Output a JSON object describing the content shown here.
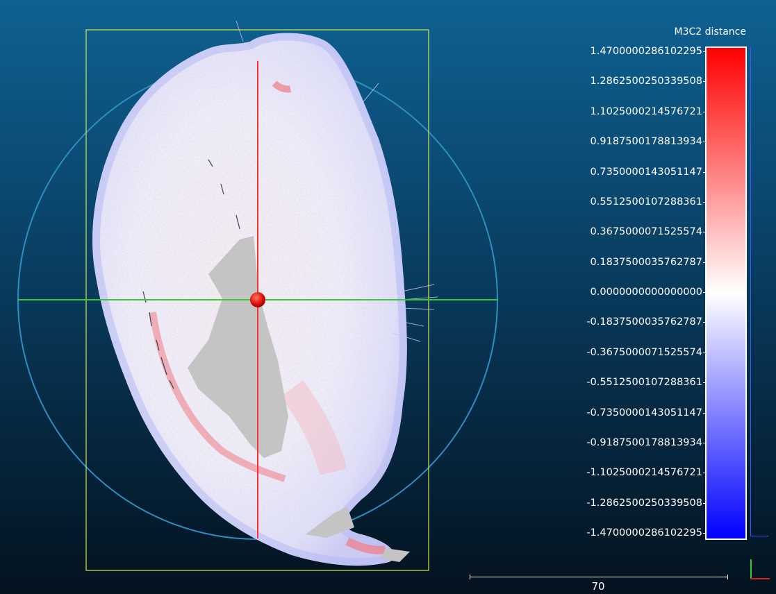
{
  "scalar_field": {
    "title": "M3C2 distance",
    "labels": [
      "1.4700000286102295",
      "1.2862500250339508",
      "1.1025000214576721",
      "0.9187500178813934",
      "0.7350000143051147",
      "0.5512500107288361",
      "0.3675000071525574",
      "0.1837500035762787",
      "0.0000000000000000",
      "-0.1837500035762787",
      "-0.3675000071525574",
      "-0.5512500107288361",
      "-0.7350000143051147",
      "-0.9187500178813934",
      "-1.1025000214576721",
      "-1.2862500250339508",
      "-1.4700000286102295"
    ],
    "colors": {
      "max": "#ff0000",
      "zero": "#ffffff",
      "min": "#0000ff"
    }
  },
  "scale": {
    "label": "70"
  },
  "colors": {
    "background_top": "#0e6192",
    "background_bottom": "#03121f",
    "bbox": "#d4e84a",
    "trackball_circle": "#2d8fbf",
    "axis_vertical": "#ff3030",
    "axis_horizontal": "#37c837",
    "pivot": "#e01010",
    "unmatched_points": "#c4c4c4"
  },
  "icons": {
    "pivot": "pivot-sphere-icon",
    "trihedron": "axes-trihedron-icon"
  }
}
